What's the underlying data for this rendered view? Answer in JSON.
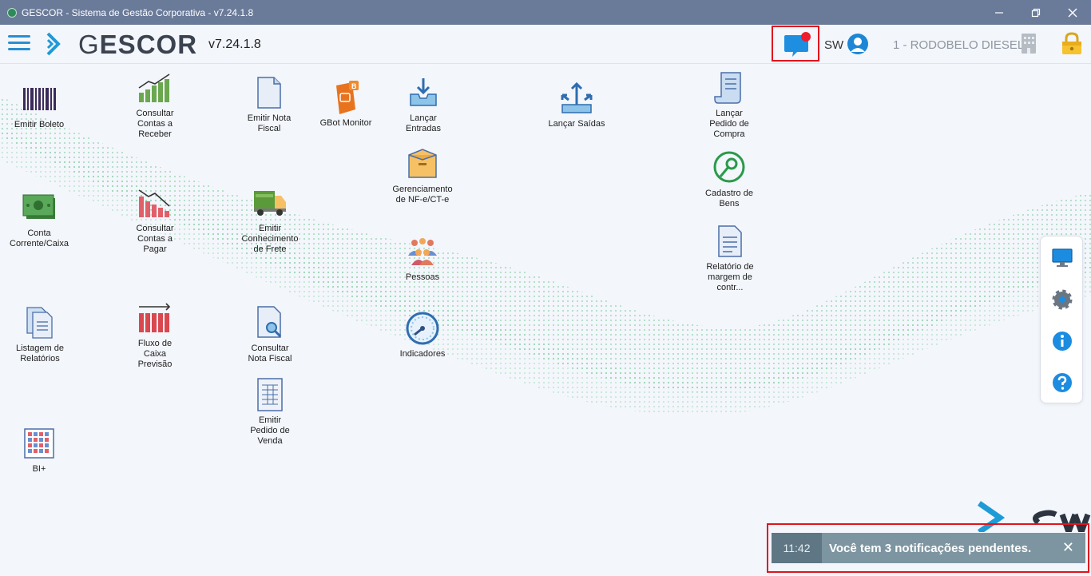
{
  "window": {
    "title": "GESCOR - Sistema de Gestão Corporativa - v7.24.1.8",
    "controls": [
      "minimize",
      "restore",
      "close"
    ]
  },
  "header": {
    "logo_g": "G",
    "logo_rest": "ESCOR",
    "version": "v7.24.1.8",
    "user": "SW",
    "company": "1 - RODOBELO DIESEL"
  },
  "tiles": [
    {
      "id": "emitir-boleto",
      "label": "Emitir Boleto",
      "icon": "barcode-icon"
    },
    {
      "id": "consultar-contas-receber",
      "label": "Consultar\nContas a\nReceber",
      "icon": "bar-chart-up-icon"
    },
    {
      "id": "emitir-nota-fiscal",
      "label": "Emitir Nota\nFiscal",
      "icon": "document-icon"
    },
    {
      "id": "gbot-monitor",
      "label": "GBot Monitor",
      "icon": "gbot-icon"
    },
    {
      "id": "lancar-entradas",
      "label": "Lançar\nEntradas",
      "icon": "inbox-download-icon"
    },
    {
      "id": "lancar-saidas",
      "label": "Lançar Saídas",
      "icon": "arrows-out-icon"
    },
    {
      "id": "lancar-pedido-compra",
      "label": "Lançar\nPedido de\nCompra",
      "icon": "scroll-icon"
    },
    {
      "id": "gerenciamento-nfe",
      "label": "Gerenciamento\nde NF-e/CT-e",
      "icon": "box-icon"
    },
    {
      "id": "cadastro-bens",
      "label": "Cadastro de\nBens",
      "icon": "pin-icon"
    },
    {
      "id": "conta-corrente",
      "label": "Conta\nCorrente/Caixa",
      "icon": "money-icon"
    },
    {
      "id": "consultar-contas-pagar",
      "label": "Consultar\nContas a\nPagar",
      "icon": "bar-chart-down-icon"
    },
    {
      "id": "emitir-conhecimento-frete",
      "label": "Emitir\nConhecimento\nde Frete",
      "icon": "truck-icon"
    },
    {
      "id": "pessoas",
      "label": "Pessoas",
      "icon": "people-icon"
    },
    {
      "id": "relatorio-margem",
      "label": "Relatório de\nmargem de\ncontr...",
      "icon": "report-icon"
    },
    {
      "id": "listagem-relatorios",
      "label": "Listagem de\nRelatórios",
      "icon": "documents-icon"
    },
    {
      "id": "fluxo-caixa",
      "label": "Fluxo de\nCaixa\nPrevisão",
      "icon": "bar-chart-arrow-icon"
    },
    {
      "id": "consultar-nota-fiscal",
      "label": "Consultar\nNota Fiscal",
      "icon": "search-document-icon"
    },
    {
      "id": "indicadores",
      "label": "Indicadores",
      "icon": "gauge-icon"
    },
    {
      "id": "emitir-pedido-venda",
      "label": "Emitir\nPedido de\nVenda",
      "icon": "spreadsheet-icon"
    },
    {
      "id": "bi-plus",
      "label": "BI+",
      "icon": "grid-chart-icon"
    }
  ],
  "side_panel": [
    "monitor-icon",
    "settings-icon",
    "info-icon",
    "help-icon"
  ],
  "toast": {
    "time": "11:42",
    "message": "Você tem 3 notificações pendentes.",
    "close": "✕"
  }
}
